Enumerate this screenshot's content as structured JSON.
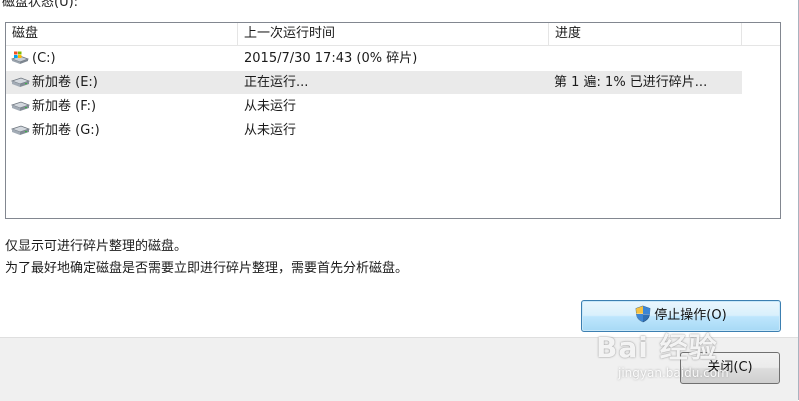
{
  "window": {
    "top_caption": "磁盘状态(U):"
  },
  "disk_list": {
    "columns": [
      "磁盘",
      "上一次运行时间",
      "进度"
    ],
    "rows": [
      {
        "disk": "(C:)",
        "last_run": "2015/7/30 17:43 (0% 碎片)",
        "progress": "",
        "icon": "system-drive-icon",
        "selected": false
      },
      {
        "disk": "新加卷 (E:)",
        "last_run": "正在运行...",
        "progress": "第 1 遍: 1% 已进行碎片...",
        "icon": "hard-drive-icon",
        "selected": true
      },
      {
        "disk": "新加卷 (F:)",
        "last_run": "从未运行",
        "progress": "",
        "icon": "hard-drive-icon",
        "selected": false
      },
      {
        "disk": "新加卷 (G:)",
        "last_run": "从未运行",
        "progress": "",
        "icon": "hard-drive-icon",
        "selected": false
      }
    ]
  },
  "info": {
    "line1": "仅显示可进行碎片整理的磁盘。",
    "line2": "为了最好地确定磁盘是否需要立即进行碎片整理，需要首先分析磁盘。"
  },
  "buttons": {
    "stop_label": "停止操作(O)",
    "close_label": "关闭(C)"
  },
  "watermark": {
    "brand": "Bai 经验",
    "url": "jingyan.baidu.com"
  },
  "colors": {
    "selected_row": "#eaeaea",
    "stop_button_border": "#3c7fb1",
    "footer_band": "#f0f0f0"
  }
}
